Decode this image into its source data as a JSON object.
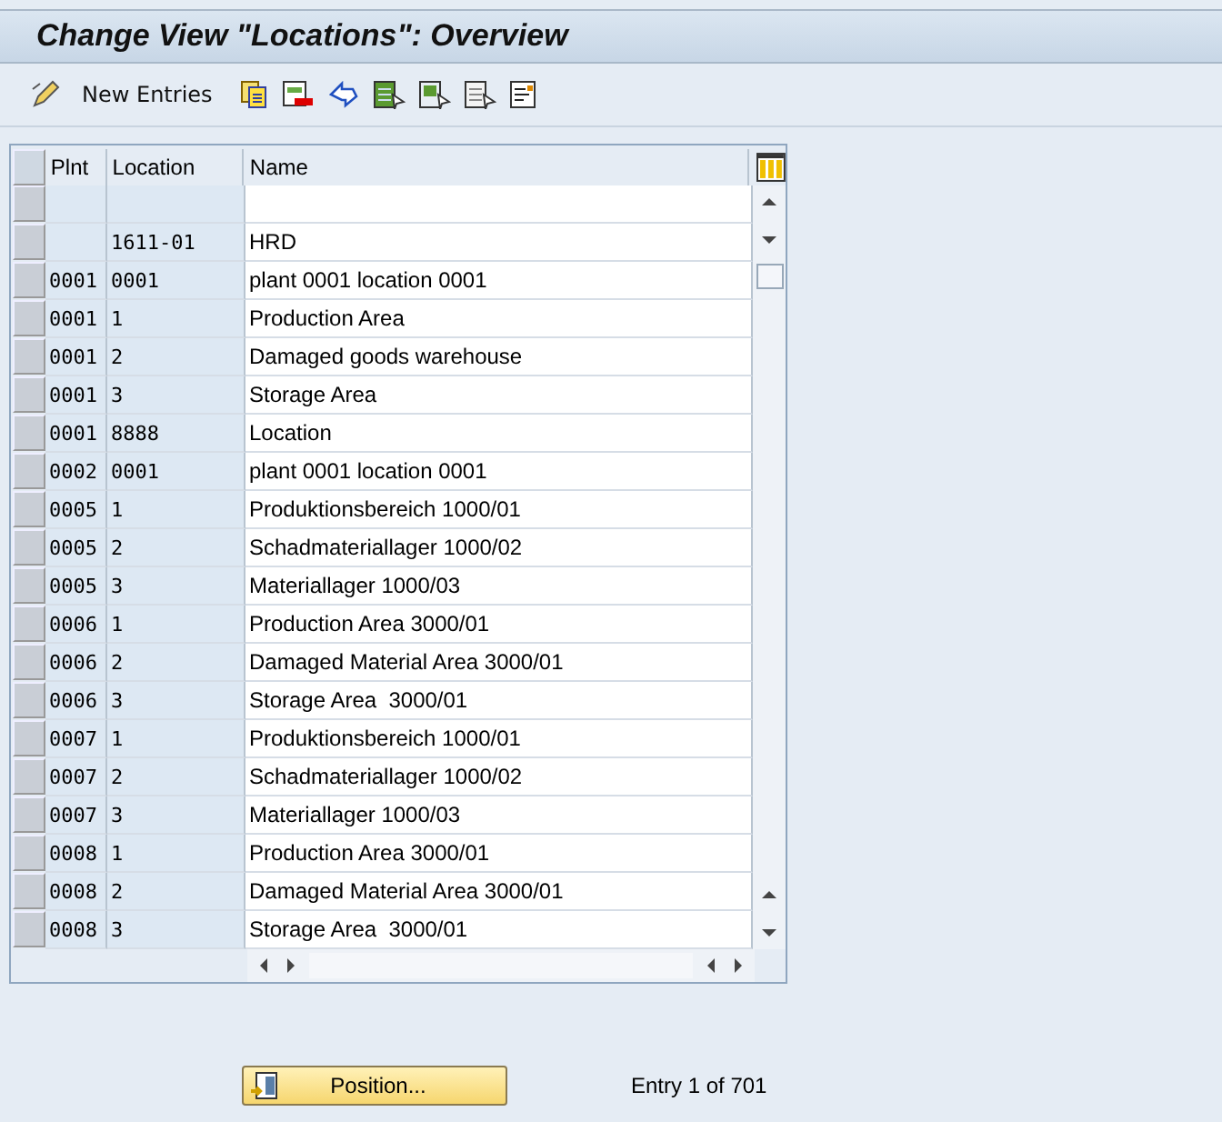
{
  "window": {
    "title": "Change View \"Locations\": Overview"
  },
  "toolbar": {
    "new_entries": "New Entries"
  },
  "table": {
    "columns": [
      "Plnt",
      "Location",
      "Name"
    ],
    "rows": [
      {
        "kind": "blank"
      },
      {
        "kind": "entry",
        "location": "1611-01",
        "name": "HRD"
      },
      {
        "kind": "entry",
        "plant": "0001",
        "location": "0001",
        "name": "plant 0001 location 0001"
      },
      {
        "kind": "entry",
        "plant": "0001",
        "location": "1",
        "name": "Production Area"
      },
      {
        "kind": "entry",
        "plant": "0001",
        "location": "2",
        "name": "Damaged goods warehouse"
      },
      {
        "kind": "entry",
        "plant": "0001",
        "location": "3",
        "name": "Storage Area"
      },
      {
        "kind": "entry",
        "plant": "0001",
        "location": "8888",
        "name": "Location"
      },
      {
        "kind": "entry",
        "plant": "0002",
        "location": "0001",
        "name": "plant 0001 location 0001"
      },
      {
        "kind": "entry",
        "plant": "0005",
        "location": "1",
        "name": "Produktionsbereich 1000/01"
      },
      {
        "kind": "entry",
        "plant": "0005",
        "location": "2",
        "name": "Schadmateriallager 1000/02"
      },
      {
        "kind": "entry",
        "plant": "0005",
        "location": "3",
        "name": "Materiallager 1000/03"
      },
      {
        "kind": "entry",
        "plant": "0006",
        "location": "1",
        "name": "Production Area 3000/01"
      },
      {
        "kind": "entry",
        "plant": "0006",
        "location": "2",
        "name": "Damaged Material Area 3000/01"
      },
      {
        "kind": "entry",
        "plant": "0006",
        "location": "3",
        "name": "Storage Area  3000/01"
      },
      {
        "kind": "entry",
        "plant": "0007",
        "location": "1",
        "name": "Produktionsbereich 1000/01"
      },
      {
        "kind": "entry",
        "plant": "0007",
        "location": "2",
        "name": "Schadmateriallager 1000/02"
      },
      {
        "kind": "entry",
        "plant": "0007",
        "location": "3",
        "name": "Materiallager 1000/03"
      },
      {
        "kind": "entry",
        "plant": "0008",
        "location": "1",
        "name": "Production Area 3000/01"
      },
      {
        "kind": "entry",
        "plant": "0008",
        "location": "2",
        "name": "Damaged Material Area 3000/01"
      },
      {
        "kind": "entry",
        "plant": "0008",
        "location": "3",
        "name": "Storage Area  3000/01"
      }
    ]
  },
  "footer": {
    "position_button": "Position...",
    "entry_info": "Entry 1 of 701"
  }
}
